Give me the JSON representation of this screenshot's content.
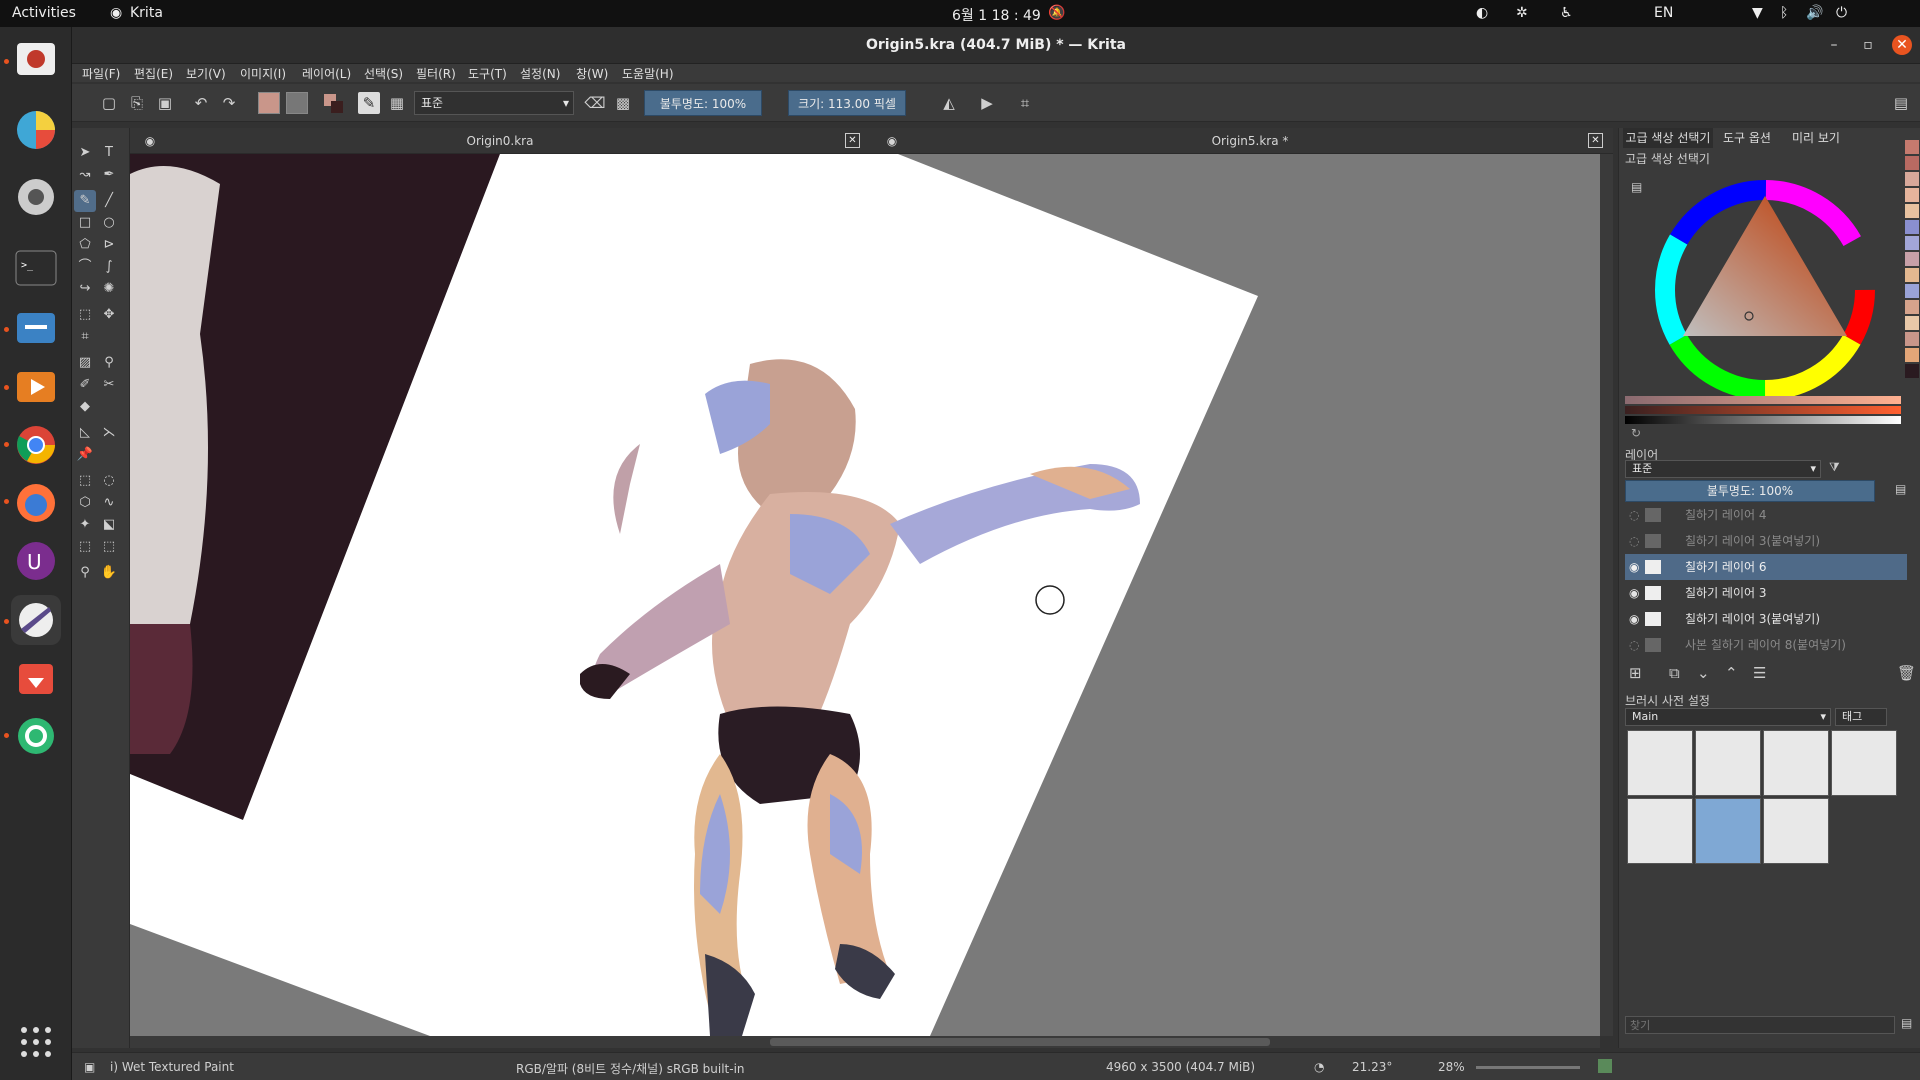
{
  "topbar": {
    "activities": "Activities",
    "app_name": "Krita",
    "clock": "6월 1  18 : 49",
    "lang": "EN"
  },
  "window": {
    "title": "Origin5.kra (404.7 MiB)  * — Krita"
  },
  "menu": [
    "파일(F)",
    "편집(E)",
    "보기(V)",
    "이미지(I)",
    "레이어(L)",
    "선택(S)",
    "필터(R)",
    "도구(T)",
    "설정(N)",
    "창(W)",
    "도움말(H)"
  ],
  "toolbar": {
    "blend_mode": "표준",
    "opacity": "불투명도: 100%",
    "size": "크기: 113.00 픽셀"
  },
  "documents": {
    "tab1": "Origin0.kra",
    "tab2": "Origin5.kra *"
  },
  "dockers": {
    "tabs": [
      "고급 색상 선택기",
      "도구 옵션",
      "미리 보기"
    ],
    "color_selector_title": "고급 색상 선택기",
    "layers_title": "레이어",
    "layer_blend": "표준",
    "layer_opacity": "불투명도:  100%",
    "layers": [
      {
        "name": "칠하기 레이어 4",
        "visible": false,
        "selected": false
      },
      {
        "name": "칠하기 레이어 3(붙여넣기)",
        "visible": false,
        "selected": false
      },
      {
        "name": "칠하기 레이어 6",
        "visible": true,
        "selected": true
      },
      {
        "name": "칠하기 레이어 3",
        "visible": true,
        "selected": false
      },
      {
        "name": "칠하기 레이어 3(붙여넣기)",
        "visible": true,
        "selected": false
      },
      {
        "name": "사본 칠하기 레이어 8(붙여넣기)",
        "visible": false,
        "selected": false
      }
    ],
    "presets_title": "브러시 사전 설정",
    "preset_group": "Main",
    "preset_tag": "태그",
    "search_placeholder": "찾기"
  },
  "status": {
    "brush": "i) Wet Textured Paint",
    "color_model": "RGB/알파 (8비트 정수/채널)  sRGB built-in",
    "image_size": "4960 x 3500 (404.7 MiB)",
    "rotation": "21.23°",
    "zoom": "28%"
  },
  "colors": {
    "accent": "#4f6a88",
    "panel": "#3a3a3a",
    "canvas_bg": "#7a7a7a"
  }
}
